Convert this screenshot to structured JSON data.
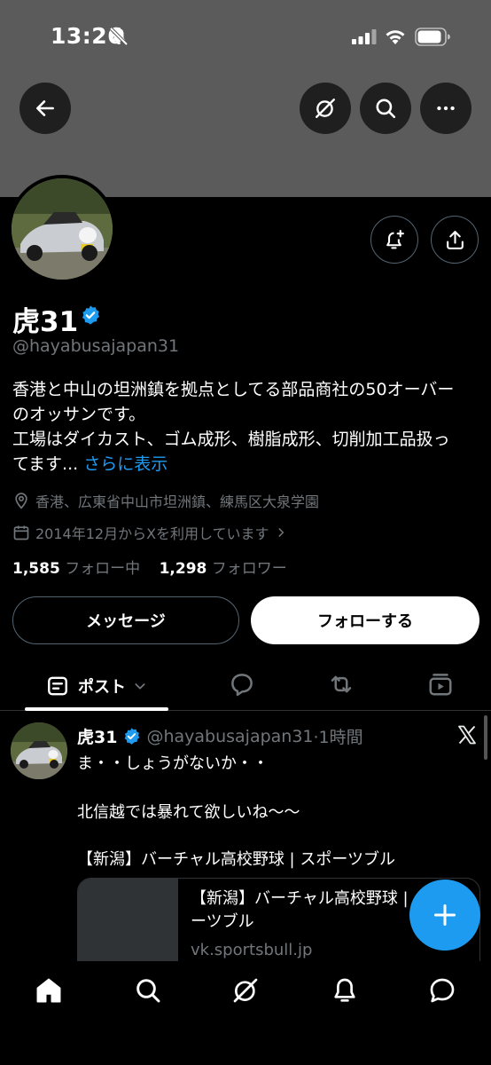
{
  "status_bar": {
    "time": "13:26"
  },
  "profile": {
    "display_name": "虎31",
    "handle": "@hayabusajapan31",
    "bio_lines": [
      "香港と中山の坦洲鎮を拠点としてる部品商社の50オーバー",
      "のオッサンです。",
      "工場はダイカスト、ゴム成形、樹脂成形、切削加工品扱っ",
      "てます... "
    ],
    "read_more": "さらに表示",
    "location": "香港、広東省中山市坦洲鎮、練馬区大泉学園",
    "joined": "2014年12月からXを利用しています",
    "following_count": "1,585",
    "following_label": "フォロー中",
    "followers_count": "1,298",
    "followers_label": "フォロワー"
  },
  "buttons": {
    "message": "メッセージ",
    "follow": "フォローする"
  },
  "tabs": {
    "posts_label": "ポスト"
  },
  "post": {
    "name": "虎31",
    "handle": "@hayabusajapan31",
    "time": "·1時間",
    "lines": [
      "ま・・しょうがないか・・",
      "北信越では暴れて欲しいね〜〜",
      "【新潟】バーチャル高校野球 | スポーツブル"
    ],
    "card_title_line1": "【新潟】バーチャル高校野球 |",
    "card_title_line2": "ーツブル",
    "card_domain": "vk.sportsbull.jp"
  },
  "colors": {
    "accent": "#1d9bf0",
    "banner": "#5b5b5b",
    "muted": "#71767b",
    "border": "#2f3336"
  },
  "icons": {
    "nav": [
      "back-arrow-icon",
      "grok-icon",
      "search-icon",
      "more-icon"
    ],
    "actions": [
      "notification-bell-plus-icon",
      "share-icon"
    ],
    "tabs": [
      "posts-icon",
      "reply-icon",
      "repost-icon",
      "video-icon"
    ],
    "bottom_nav": [
      "home-icon",
      "search-icon",
      "grok-icon",
      "bell-icon",
      "messages-icon"
    ]
  }
}
